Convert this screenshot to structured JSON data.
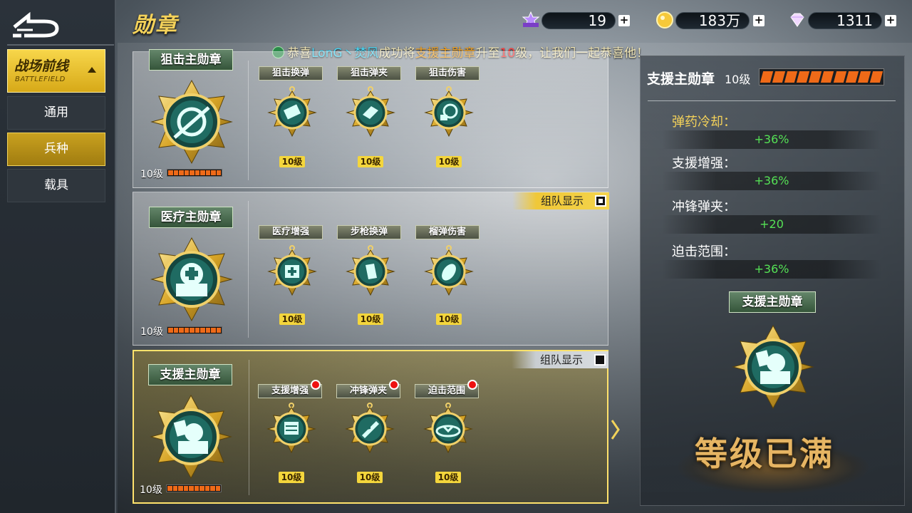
{
  "header": {
    "title": "勋章"
  },
  "resources": [
    {
      "name": "功勋点",
      "icon": "merit-badge-icon",
      "value": "19"
    },
    {
      "name": "金币",
      "icon": "gold-coin-icon",
      "value": "183万"
    },
    {
      "name": "钻石",
      "icon": "diamond-icon",
      "value": "1311"
    }
  ],
  "plus_label": "+",
  "broadcast": {
    "p1": "恭喜",
    "player": "LonG丶焚风",
    "p2": "成功将",
    "medal": "支援主勋章",
    "p3": "升至",
    "level": "10",
    "p4": "级，让我们一起恭喜他！"
  },
  "sidebar": {
    "category": {
      "title": "战场前线",
      "subtitle": "BATTLEFIELD"
    },
    "items": [
      {
        "label": "通用"
      },
      {
        "label": "兵种"
      },
      {
        "label": "载具"
      }
    ],
    "active_index": 1
  },
  "team_display_label": "组队显示",
  "cards": [
    {
      "title": "狙击主勋章",
      "level": "10级",
      "progress": 1.0,
      "subs": [
        {
          "name": "狙击换弹",
          "level": "10级"
        },
        {
          "name": "狙击弹夹",
          "level": "10级"
        },
        {
          "name": "狙击伤害",
          "level": "10级"
        }
      ]
    },
    {
      "title": "医疗主勋章",
      "level": "10级",
      "progress": 1.0,
      "team_display": true,
      "subs": [
        {
          "name": "医疗增强",
          "level": "10级"
        },
        {
          "name": "步枪换弹",
          "level": "10级"
        },
        {
          "name": "榴弹伤害",
          "level": "10级"
        }
      ]
    },
    {
      "title": "支援主勋章",
      "level": "10级",
      "progress": 1.0,
      "team_display": false,
      "selected": true,
      "subs": [
        {
          "name": "支援增强",
          "level": "10级"
        },
        {
          "name": "冲锋弹夹",
          "level": "10级"
        },
        {
          "name": "迫击范围",
          "level": "10级"
        }
      ]
    }
  ],
  "detail": {
    "name": "支援主勋章",
    "level": "10级",
    "progress": 1.0,
    "stats": [
      {
        "label": "弹药冷却：",
        "value": "+36%"
      },
      {
        "label": "支援增强：",
        "value": "+36%"
      },
      {
        "label": "冲锋弹夹：",
        "value": "+20"
      },
      {
        "label": "迫击范围：",
        "value": "+36%"
      }
    ],
    "medal_title": "支援主勋章",
    "status": "等级已满"
  },
  "colors": {
    "gold": "#f4d25a",
    "orange_bar": "#ef6a18",
    "stat_green": "#55e255",
    "medal_teal": "#1f6b62"
  }
}
